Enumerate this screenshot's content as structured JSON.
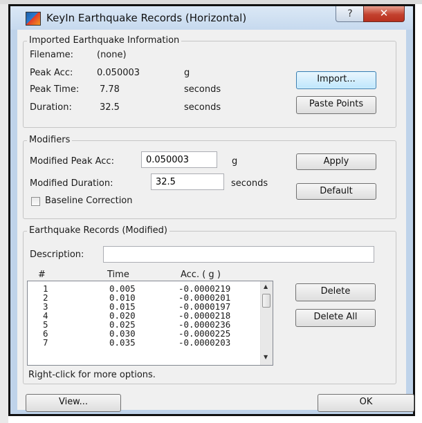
{
  "window": {
    "title": "KeyIn Earthquake Records (Horizontal)",
    "help_glyph": "?",
    "close_glyph": "✕"
  },
  "imported": {
    "legend": "Imported Earthquake Information",
    "filename_label": "Filename:",
    "filename_value": "(none)",
    "peak_acc_label": "Peak Acc:",
    "peak_acc_value": "0.050003",
    "peak_acc_unit": "g",
    "peak_time_label": "Peak Time:",
    "peak_time_value": "7.78",
    "peak_time_unit": "seconds",
    "duration_label": "Duration:",
    "duration_value": "32.5",
    "duration_unit": "seconds",
    "import_button": "Import...",
    "paste_button": "Paste Points"
  },
  "modifiers": {
    "legend": "Modifiers",
    "peak_acc_label": "Modified Peak Acc:",
    "peak_acc_value": "0.050003",
    "peak_acc_unit": "g",
    "duration_label": "Modified Duration:",
    "duration_value": "32.5",
    "duration_unit": "seconds",
    "baseline_label": "Baseline Correction",
    "apply_button": "Apply",
    "default_button": "Default"
  },
  "records": {
    "legend": "Earthquake Records (Modified)",
    "description_label": "Description:",
    "description_value": "",
    "columns": [
      "#",
      "Time",
      "Acc. ( g )"
    ],
    "rows": [
      [
        "1",
        "0.005",
        "-0.0000219"
      ],
      [
        "2",
        "0.010",
        "-0.0000201"
      ],
      [
        "3",
        "0.015",
        "-0.0000197"
      ],
      [
        "4",
        "0.020",
        "-0.0000218"
      ],
      [
        "5",
        "0.025",
        "-0.0000236"
      ],
      [
        "6",
        "0.030",
        "-0.0000225"
      ],
      [
        "7",
        "0.035",
        "-0.0000203"
      ]
    ],
    "delete_button": "Delete",
    "delete_all_button": "Delete All",
    "hint": "Right-click for more options."
  },
  "footer": {
    "view_button": "View...",
    "ok_button": "OK"
  }
}
